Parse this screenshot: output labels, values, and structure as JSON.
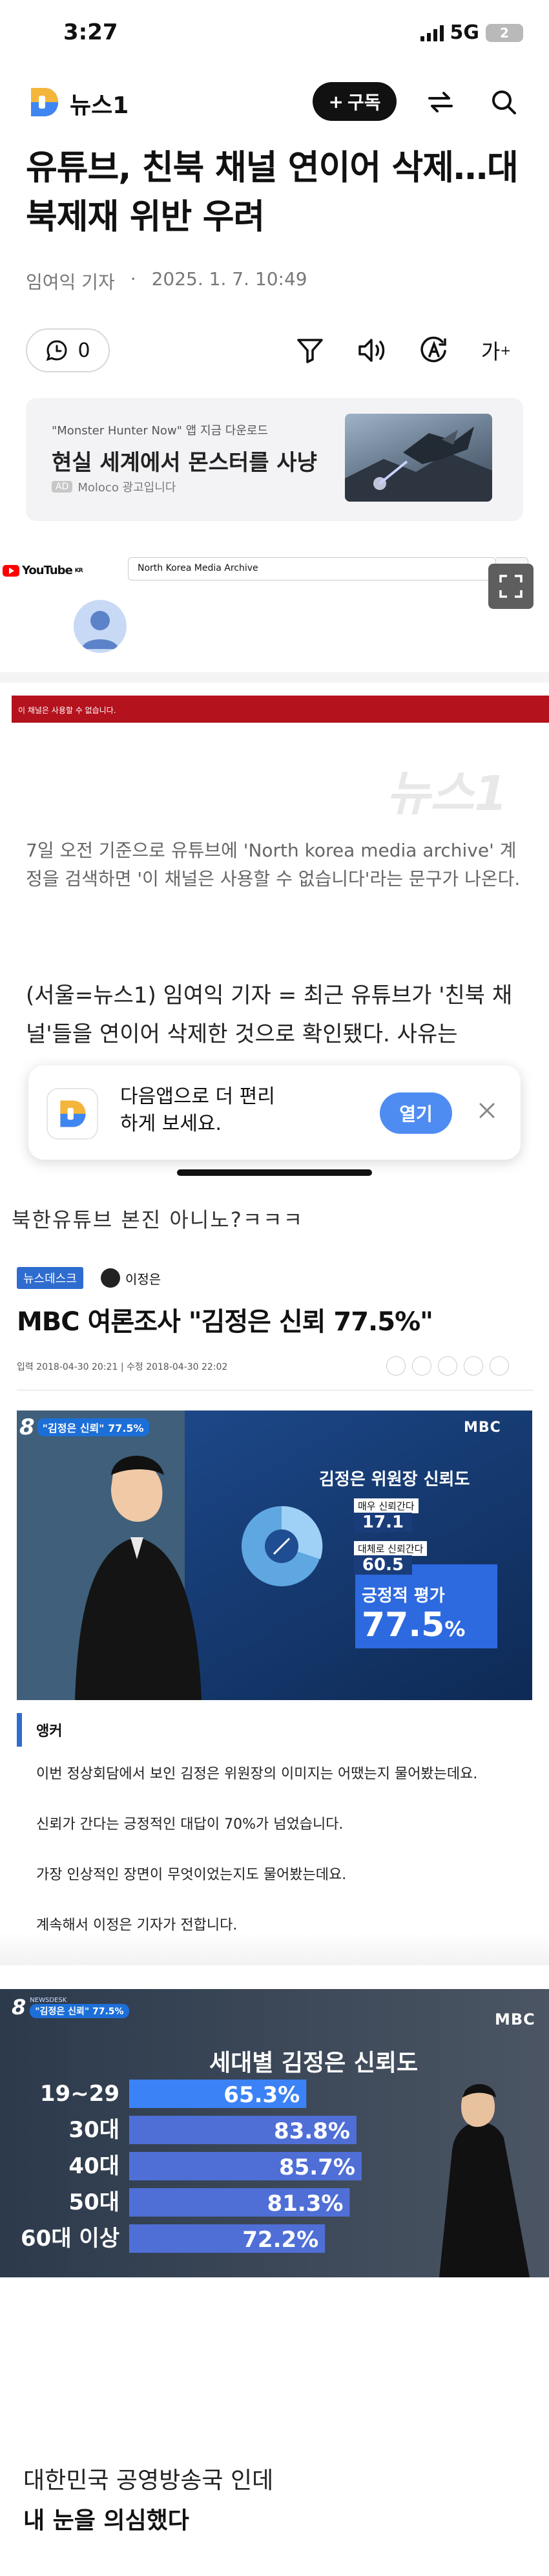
{
  "status_bar": {
    "time": "3:27",
    "network": "5G",
    "battery": "2"
  },
  "header": {
    "logo_text": "뉴스1",
    "subscribe_label": "구독"
  },
  "article": {
    "title": "유튜브, 친북 채널 연이어 삭제…대북제재 위반 우려",
    "reporter": "임여익 기자",
    "date": "2025. 1. 7. 10:49",
    "comment_count": "0",
    "font_size_icon": "가",
    "image_caption": "7일 오전 기준으로 유튜브에 'North korea media archive' 계정을 검색하면 '이 채널은 사용할 수 없습니다'라는 문구가 나온다.",
    "body_lead": "(서울=뉴스1) 임여익 기자 = 최근 유튜브가 '친북 채널'들을 연이어 삭제한 것으로 확인됐다. 사유는"
  },
  "ad": {
    "app_line": "\"Monster Hunter Now\" 앱 지금 다운로드",
    "headline": "현실 세계에서 몬스터를 사냥",
    "tag": "AD",
    "source": "Moloco 광고입니다"
  },
  "youtube": {
    "logo": "YouTube",
    "logo_suffix": "KR",
    "search_value": "North Korea Media Archive",
    "unavailable": "이 채널은 사용할 수 없습니다.",
    "watermark": "뉴스1"
  },
  "banner": {
    "text": "다음앱으로 더 편리하게 보세요.",
    "open_label": "열기"
  },
  "post": {
    "comment_line": "북한유튜브 본진 아니노?ㅋㅋㅋ"
  },
  "mbc_article": {
    "section": "뉴스데스크",
    "reporter": "이정은",
    "title": "MBC 여론조사 \"김정은 신뢰 77.5%\"",
    "dates": "입력 2018-04-30 20:21 | 수정 2018-04-30 22:02",
    "anchor_label": "앵커",
    "paragraphs": [
      "이번 정상회담에서 보인 김정은 위원장의 이미지는 어땠는지 물어봤는데요.",
      "신뢰가 간다는 긍정적인 대답이 70%가 넘었습니다.",
      "가장 인상적인 장면이 무엇이었는지도 물어봤는데요.",
      "계속해서 이정은 기자가 전합니다."
    ]
  },
  "poll_graphic": {
    "badge": "\"김정은 신뢰\" 77.5%",
    "badge_prefix": "8",
    "badge_small": "NEWSDESK",
    "network": "MBC",
    "title": "김정은 위원장 신뢰도",
    "items": [
      {
        "label": "매우 신뢰간다",
        "value": "17.1"
      },
      {
        "label": "대체로 신뢰간다",
        "value": "60.5"
      }
    ],
    "positive_label": "긍정적 평가",
    "positive_value": "77.5",
    "percent_sign": "%"
  },
  "chart_data": {
    "type": "bar",
    "title": "세대별 김정은 신뢰도",
    "categories": [
      "19~29",
      "30대",
      "40대",
      "50대",
      "60대 이상"
    ],
    "values": [
      65.3,
      83.8,
      85.7,
      81.3,
      72.2
    ],
    "value_labels": [
      "65.3%",
      "83.8%",
      "85.7%",
      "81.3%",
      "72.2%"
    ],
    "ylim": [
      0,
      100
    ]
  },
  "footer": {
    "line1": "대한민국 공영방송국 인데",
    "line2": "내 눈을 의심했다"
  },
  "colors": {
    "accent_blue": "#2f6ccf",
    "youtube_red": "#b4121d",
    "banner_button": "#4f8cf2"
  }
}
